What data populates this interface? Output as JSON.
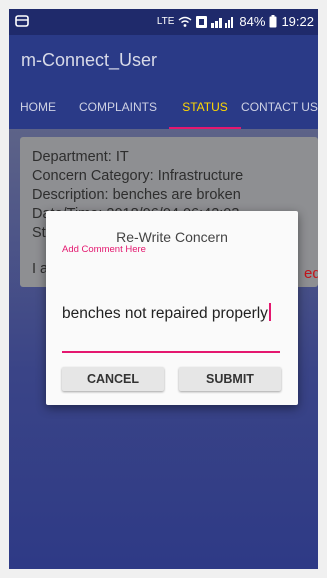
{
  "status_bar": {
    "network": "LTE",
    "battery": "84%",
    "time": "19:22"
  },
  "app": {
    "title": "m-Connect_User"
  },
  "tabs": [
    {
      "label": "HOME"
    },
    {
      "label": "COMPLAINTS"
    },
    {
      "label": "STATUS",
      "active": true
    },
    {
      "label": "CONTACT US"
    }
  ],
  "card": {
    "department": "Department: IT",
    "category": "Concern Category: Infrastructure",
    "description": "Description: benches are broken",
    "datetime": "Date/Time: 2018/06/04 06:42:03",
    "status_fragment": "St",
    "line_fragment": "I a",
    "red_fragment": "ed"
  },
  "dialog": {
    "title": "Re-Write Concern",
    "hint": "Add Comment Here",
    "value": "benches not repaired properly",
    "cancel_label": "CANCEL",
    "submit_label": "SUBMIT"
  },
  "colors": {
    "primary": "#2a3a87",
    "accent": "#e4176f",
    "active_tab": "#ffd800"
  }
}
